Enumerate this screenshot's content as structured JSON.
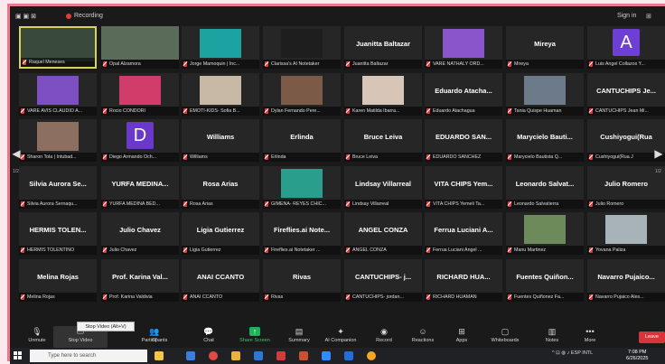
{
  "topbar": {
    "recording": "Recording",
    "sign_in": "Sign in"
  },
  "gallery": {
    "page_left": "1/2",
    "page_right": "1/2",
    "tiles": [
      [
        "Raquel Meneses",
        "Opal Alzamora",
        "Jorge Mamoquin | Inc...",
        "Clarissa's AI Notetaker",
        "Juanitta Baltazar",
        "VARE NATHALY ORD...",
        "Mireya",
        "Luis Angel Collazos Y..."
      ],
      [
        "VARE AVIS CLAUDIO A...",
        "Rocio CONDORI",
        "EMOTI-KIDS- Sofia B...",
        "Dylan Fernando Pere...",
        "Karen Matilda Ibarra...",
        "Eduardo Atachagua",
        "Tania Quispe Huaman",
        "CANTUCHIPS Jean Mi..."
      ],
      [
        "Sharon Tola | Intubad...",
        "Diego Armando Och...",
        "Williams",
        "Erlinda",
        "Bruce Leiva",
        "EDUARDO SANCHEZ",
        "Marycielo Bautista Q...",
        "Cushiyogui(Rua J"
      ],
      [
        "Silvia Aurora Sernaqu...",
        "YURFA MEDINA BED...",
        "Rosa Arias",
        "GIMENA- REYES CHIC...",
        "Lindsay Villarreal",
        "VITA CHIPS Yemeli Ta...",
        "Leonardo Salvatierra",
        "Julio Romero"
      ],
      [
        "HERMIS TOLENTINO",
        "Julio Chavez",
        "Ligia Gutierrez",
        "Fireflies.ai Notetaker ...",
        "ANGEL CONZA",
        "Ferrua Luciani Angel ...",
        "Manu Martinez",
        "Yovana Paliza"
      ],
      [
        "Melina Rojas",
        "Prof. Karina Valdivia",
        "ANAI CCANTO",
        "Rivas",
        "CANTUCHIPS- jordan...",
        "RICHARD HUAMAN",
        "Fuentes Quiñonez Fa...",
        "Navarro Pujaico Ales..."
      ]
    ],
    "big_names": {
      "r0c4": "Juanitta Baltazar",
      "r0c6": "Mireya",
      "r1c5": "Eduardo Atacha...",
      "r1c7": "CANTUCHIPS Je...",
      "r2c2": "Williams",
      "r2c3": "Erlinda",
      "r2c4": "Bruce Leiva",
      "r2c5": "EDUARDO SAN...",
      "r2c6": "Marycielo Bauti...",
      "r2c7": "Cushiyogui(Rua",
      "r3c0": "Silvia Aurora Se...",
      "r3c1": "YURFA MEDINA...",
      "r3c2": "Rosa Arias",
      "r3c4": "Lindsay Villarreal",
      "r3c5": "VITA CHIPS Yem...",
      "r3c6": "Leonardo Salvat...",
      "r3c7": "Julio Romero",
      "r4c0": "HERMIS TOLEN...",
      "r4c1": "Julio Chavez",
      "r4c2": "Ligia Gutierrez",
      "r4c3": "Fireflies.ai Note...",
      "r4c4": "ANGEL CONZA",
      "r4c5": "Ferrua Luciani A...",
      "r5c0": "Melina Rojas",
      "r5c1": "Prof. Karina Val...",
      "r5c2": "ANAI CCANTO",
      "r5c3": "Rivas",
      "r5c4": "CANTUCHIPS- j...",
      "r5c5": "RICHARD HUA...",
      "r5c6": "Fuentes Quiñon...",
      "r5c7": "Navarro Pujaico..."
    },
    "avatars": {
      "r0c7": "A",
      "r2c1": "D"
    }
  },
  "toolbar": {
    "unmute": "Unmute",
    "stop_video": "Stop Video",
    "participants": "Participants",
    "participants_count": "67",
    "chat": "Chat",
    "share": "Share Screen",
    "summary": "Summary",
    "ai": "AI Companion",
    "record": "Record",
    "reactions": "Reactions",
    "apps": "Apps",
    "whiteboards": "Whiteboards",
    "notes": "Notes",
    "more": "More",
    "leave": "Leave",
    "tooltip": "Stop Video (Alt+V)"
  },
  "taskbar": {
    "search_placeholder": "Type here to search",
    "lang": "ESP",
    "region": "INTL",
    "time": "7:08 PM",
    "date": "6/26/2025"
  },
  "colors": {
    "accent": "#e87a90",
    "selected_border": "#d9d35a",
    "share_green": "#1fb15b",
    "leave_red": "#d9343a",
    "avatar_a": "#6d3fd4",
    "avatar_d": "#6a39c9"
  }
}
